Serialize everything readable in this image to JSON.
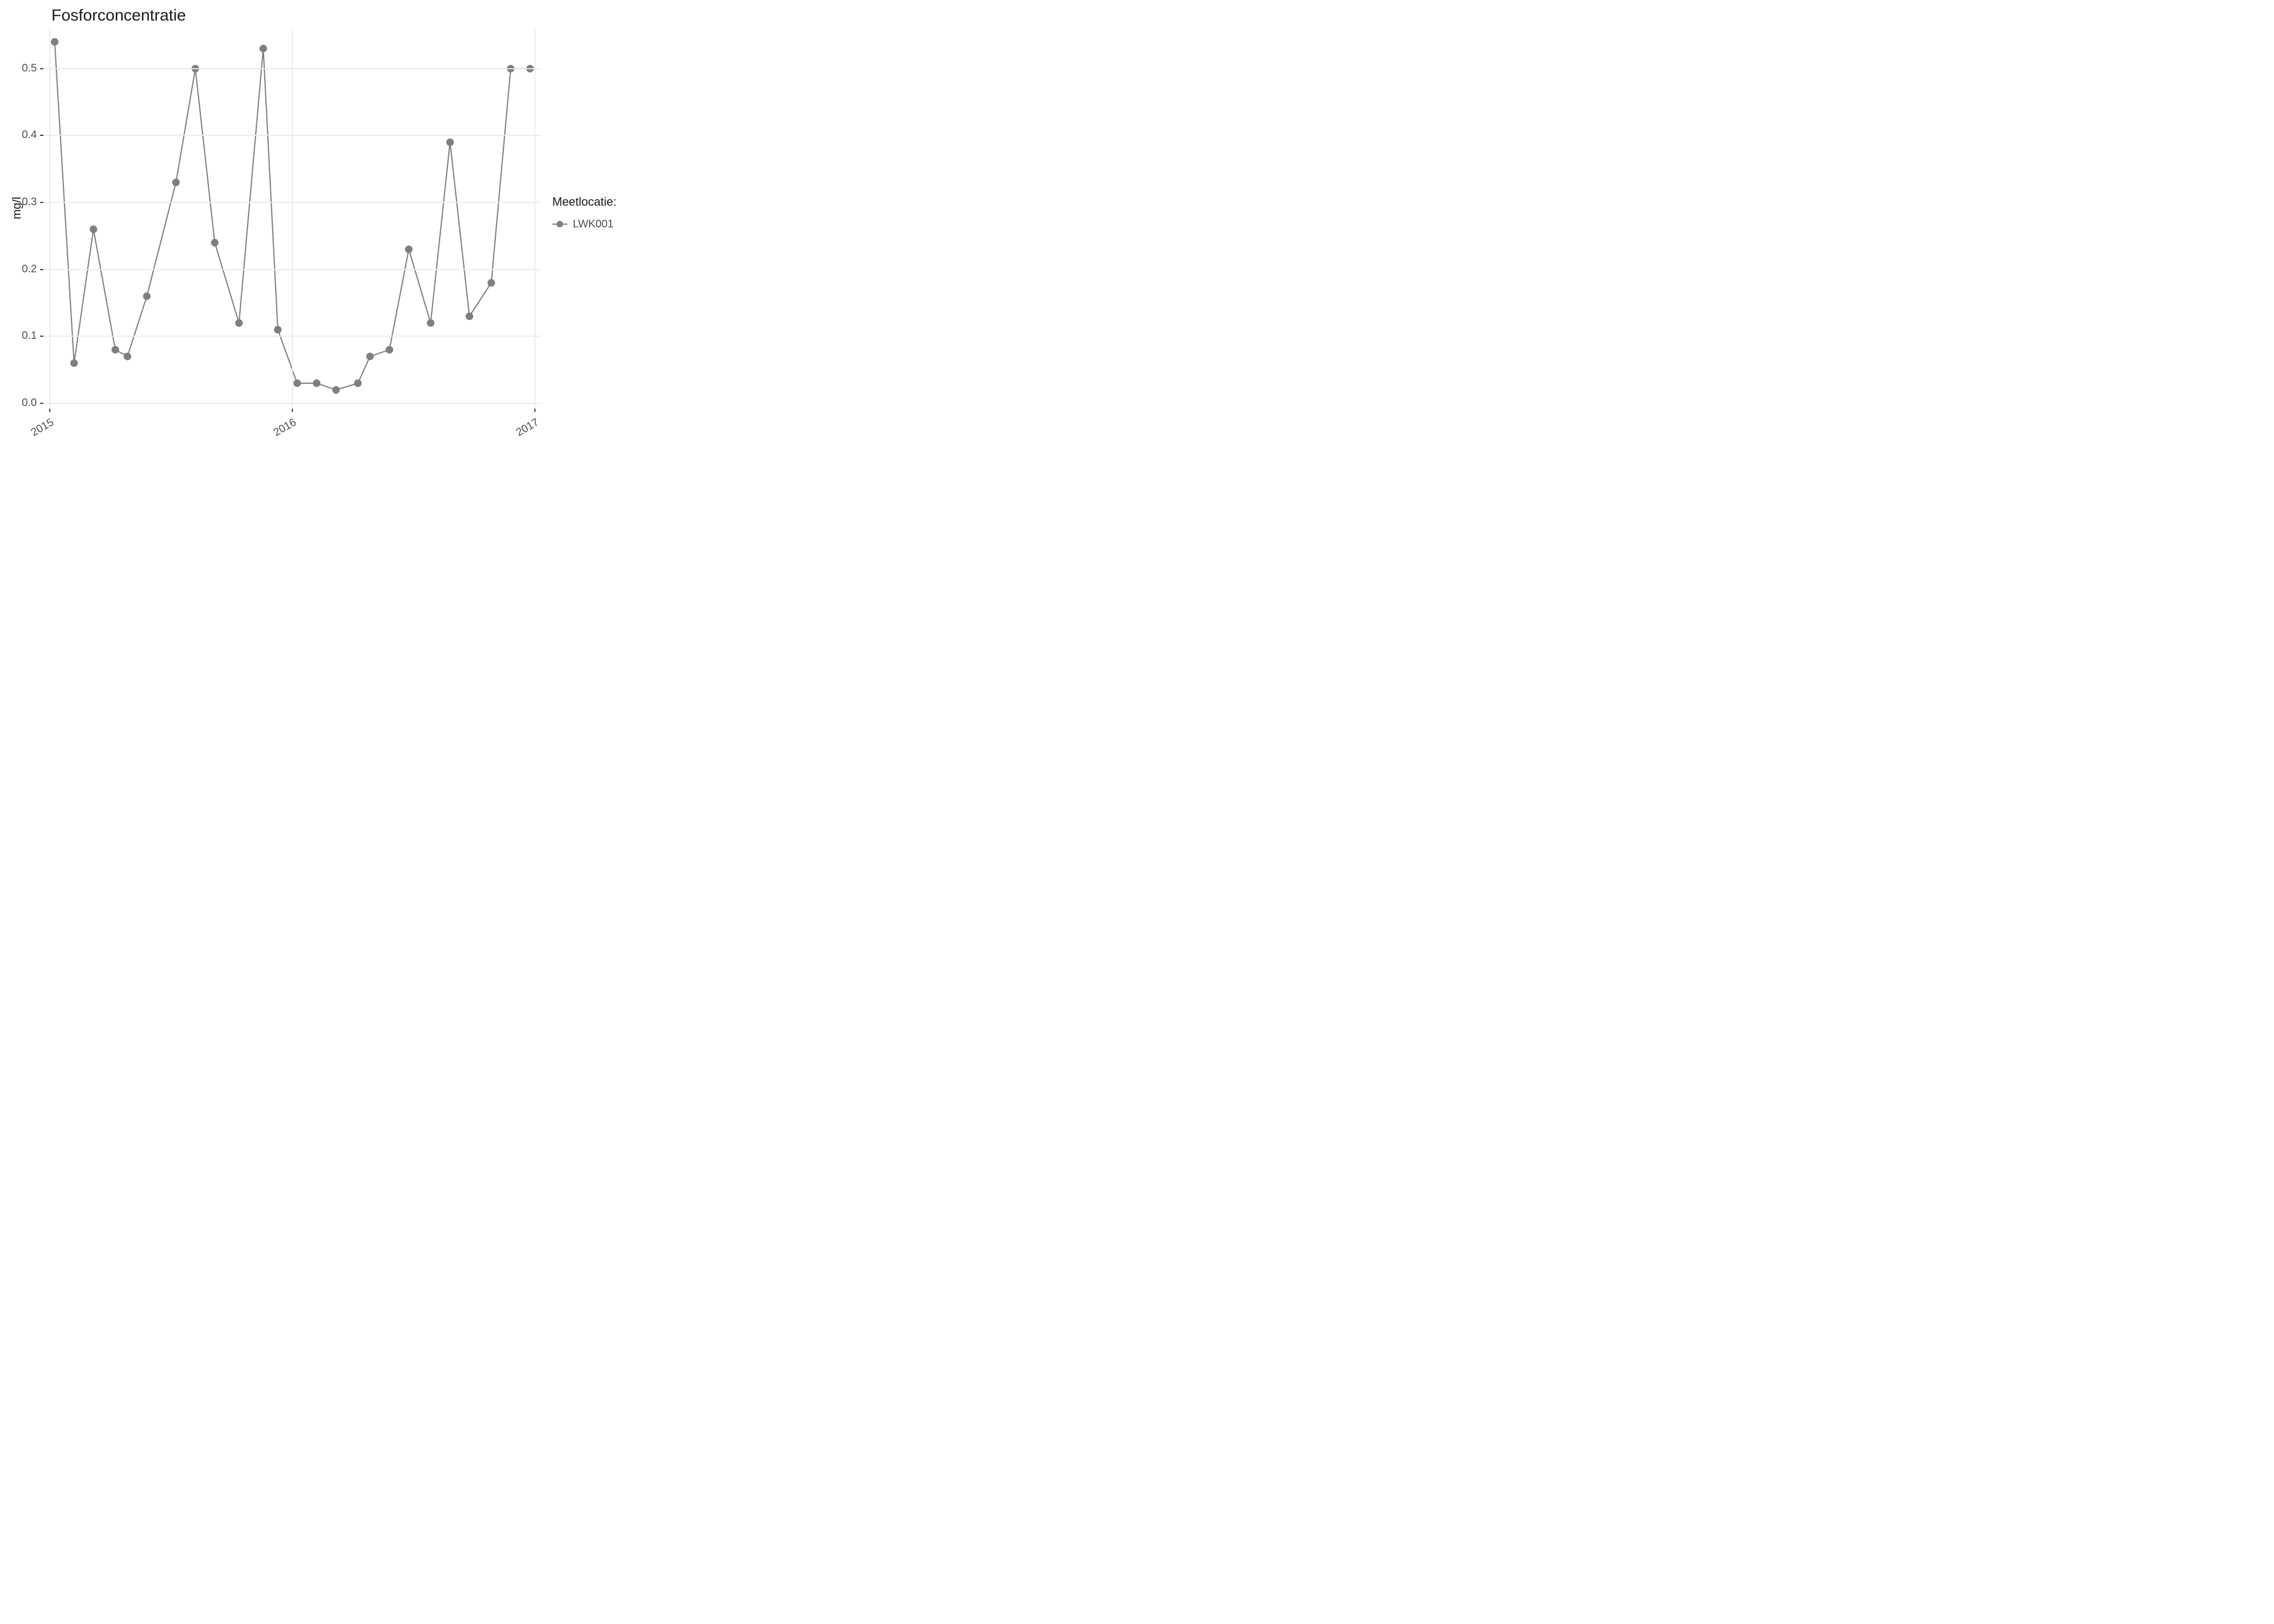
{
  "chart_data": {
    "type": "line",
    "title": "Fosforconcentratie",
    "xlabel": "",
    "ylabel": "mg/l",
    "xlim": [
      2015.0,
      2017.0
    ],
    "ylim": [
      0.0,
      0.55
    ],
    "x_ticks": [
      2015,
      2016,
      2017
    ],
    "y_ticks": [
      0.0,
      0.1,
      0.2,
      0.3,
      0.4,
      0.5
    ],
    "y_tick_labels": [
      "0.0",
      "0.1",
      "0.2",
      "0.3",
      "0.4",
      "0.5"
    ],
    "series": [
      {
        "name": "LWK001",
        "x": [
          2015.02,
          2015.1,
          2015.18,
          2015.27,
          2015.32,
          2015.4,
          2015.52,
          2015.6,
          2015.68,
          2015.78,
          2015.88,
          2015.94,
          2016.02,
          2016.1,
          2016.18,
          2016.27,
          2016.32,
          2016.4,
          2016.48,
          2016.57,
          2016.65,
          2016.73,
          2016.82,
          2016.9,
          2016.98
        ],
        "values": [
          0.54,
          0.06,
          0.26,
          0.08,
          0.07,
          0.16,
          0.33,
          0.5,
          0.24,
          0.12,
          0.53,
          0.11,
          0.03,
          0.03,
          0.02,
          0.03,
          0.07,
          0.08,
          0.23,
          0.12,
          0.39,
          0.13,
          0.18,
          0.5,
          0.5
        ]
      }
    ],
    "legend_title": "Meetlocatie:",
    "legend_position": "right",
    "grid": true
  },
  "colors": {
    "series": "#7f7f7f",
    "grid": "#ebebeb",
    "text": "#1a1a1a",
    "tick_text": "#4d4d4d"
  }
}
